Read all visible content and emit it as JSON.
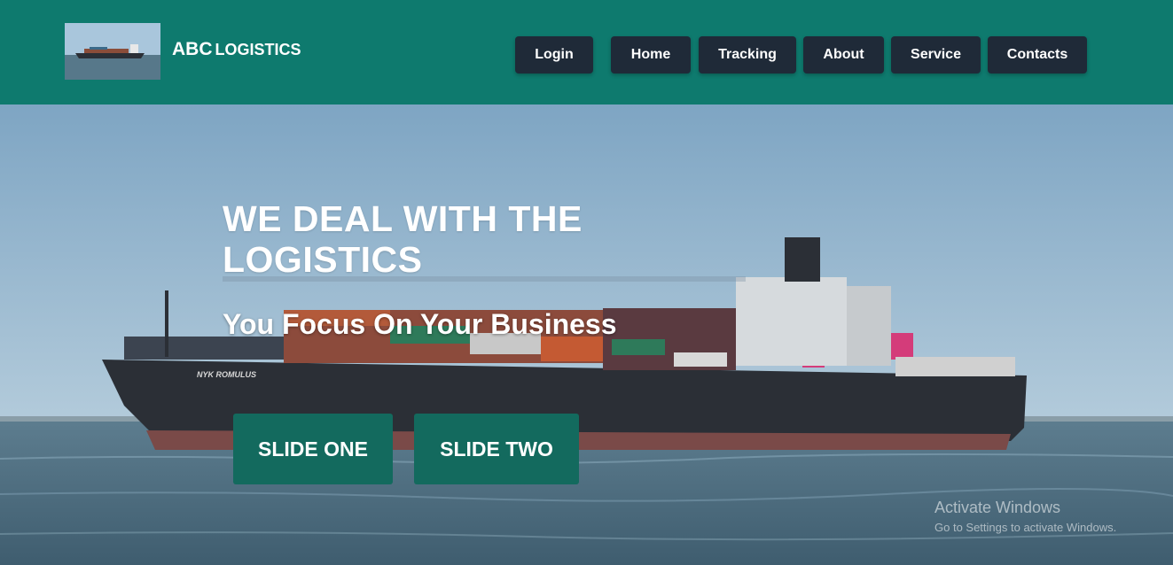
{
  "header": {
    "brand_main": "ABC",
    "brand_sub": "LOGISTICS",
    "nav": {
      "login": "Login",
      "home": "Home",
      "tracking": "Tracking",
      "about": "About",
      "service": "Service",
      "contacts": "Contacts"
    }
  },
  "hero": {
    "headline_line1": "WE DEAL WITH THE",
    "headline_line2": "LOGISTICS",
    "subheadline": "You Focus On Your Business",
    "ship_name": "NYK ROMULUS",
    "buttons": {
      "slide_one": "SLIDE ONE",
      "slide_two": "SLIDE TWO"
    }
  },
  "watermark": {
    "title": "Activate Windows",
    "subtitle": "Go to Settings to activate Windows."
  },
  "colors": {
    "header_bg": "#0e7a6e",
    "nav_button_bg": "#1f2a38",
    "slide_button_bg": "#136a5e"
  }
}
